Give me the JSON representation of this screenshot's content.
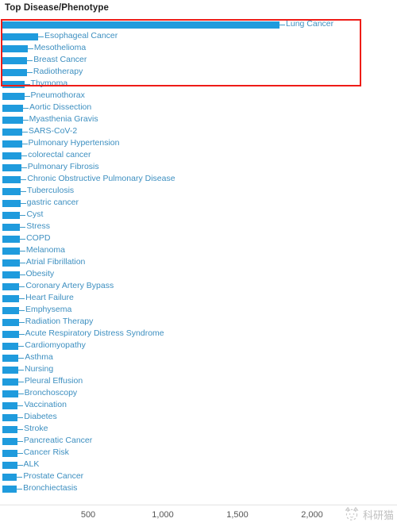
{
  "chart_title": "Top Disease/Phenotype",
  "watermark": {
    "text": "科研猫",
    "icon": "cat-face-icon"
  },
  "axis": {
    "tick_labels": [
      "500",
      "1,000",
      "1,500",
      "2,000"
    ],
    "tick_values": [
      500,
      1000,
      1500,
      2000
    ]
  },
  "highlight": {
    "color": "#ee1c17",
    "note": "red rectangle around top five bars"
  },
  "chart_data": {
    "type": "bar",
    "orientation": "horizontal",
    "title": "Top Disease/Phenotype",
    "xlabel": "",
    "ylabel": "",
    "xlim": [
      0,
      2100
    ],
    "grid": false,
    "legend": false,
    "bar_color": "#1f9bdd",
    "label_color": "#3d8fc0",
    "categories": [
      "Lung Cancer",
      "Esophageal Cancer",
      "Mesothelioma",
      "Breast Cancer",
      "Radiotherapy",
      "Thymoma",
      "Pneumothorax",
      "Aortic Dissection",
      "Myasthenia Gravis",
      "SARS-CoV-2",
      "Pulmonary Hypertension",
      "colorectal cancer",
      "Pulmonary Fibrosis",
      "Chronic Obstructive Pulmonary Disease",
      "Tuberculosis",
      "gastric cancer",
      "Cyst",
      "Stress",
      "COPD",
      "Melanoma",
      "Atrial Fibrillation",
      "Obesity",
      "Coronary Artery Bypass",
      "Heart Failure",
      "Emphysema",
      "Radiation Therapy",
      "Acute Respiratory Distress Syndrome",
      "Cardiomyopathy",
      "Asthma",
      "Nursing",
      "Pleural Effusion",
      "Bronchoscopy",
      "Vaccination",
      "Diabetes",
      "Stroke",
      "Pancreatic Cancer",
      "Cancer Risk",
      "ALK",
      "Prostate Cancer",
      "Bronchiectasis"
    ],
    "values": [
      1782,
      165,
      95,
      92,
      90,
      72,
      72,
      64,
      62,
      58,
      56,
      54,
      52,
      50,
      48,
      46,
      45,
      44,
      43,
      42,
      41,
      40,
      39,
      38,
      37,
      36,
      35,
      34,
      33,
      32,
      31,
      30,
      29,
      28,
      27,
      26,
      25,
      24,
      23,
      22
    ]
  }
}
